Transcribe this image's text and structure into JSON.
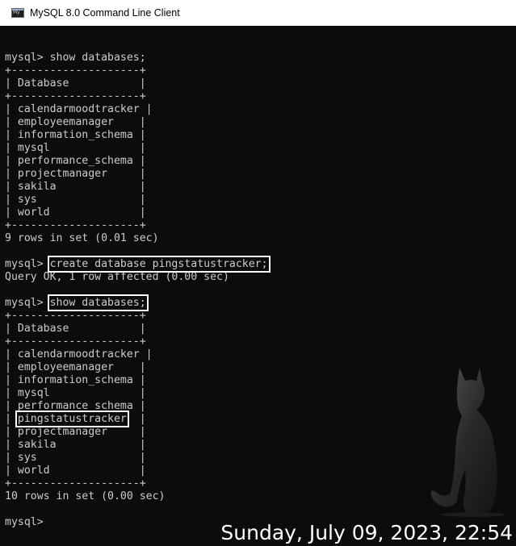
{
  "window": {
    "title": "MySQL 8.0 Command Line Client",
    "icon": "mysql-console-icon"
  },
  "terminal": {
    "lines": [
      "",
      "mysql> show databases;",
      "+--------------------+",
      "| Database           |",
      "+--------------------+",
      "| calendarmoodtracker |",
      "| employeemanager    |",
      "| information_schema |",
      "| mysql              |",
      "| performance_schema |",
      "| projectmanager     |",
      "| sakila             |",
      "| sys                |",
      "| world              |",
      "+--------------------+",
      "9 rows in set (0.01 sec)",
      "",
      "mysql> create database pingstatustracker;",
      "Query OK, 1 row affected (0.00 sec)",
      "",
      "mysql> show databases;",
      "+--------------------+",
      "| Database           |",
      "+--------------------+",
      "| calendarmoodtracker |",
      "| employeemanager    |",
      "| information_schema |",
      "| mysql              |",
      "| performance_schema |",
      "| pingstatustracker  |",
      "| projectmanager     |",
      "| sakila             |",
      "| sys                |",
      "| world              |",
      "+--------------------+",
      "10 rows in set (0.00 sec)",
      "",
      "mysql>"
    ],
    "highlighted": [
      {
        "line": 17,
        "text": "create database pingstatustracker;"
      },
      {
        "line": 20,
        "text": "show databases;"
      },
      {
        "line": 29,
        "text": "pingstatustracker"
      }
    ],
    "colors": {
      "background": "#0c0c0c",
      "text": "#cccccc",
      "highlight_box": "#ffffff"
    }
  },
  "overlay": {
    "datetime": "Sunday, July 09, 2023, 22:54",
    "cat_figure": "cat-silhouette"
  }
}
